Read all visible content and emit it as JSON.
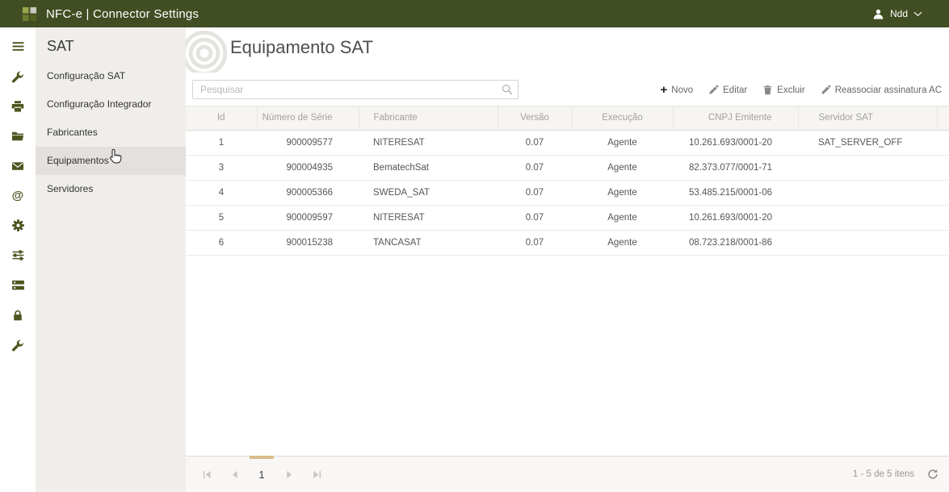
{
  "topbar": {
    "title": "NFC-e | Connector Settings",
    "user_name": "Ndd"
  },
  "sidebar": {
    "title": "SAT",
    "items": [
      {
        "label": "Configuração SAT",
        "active": false
      },
      {
        "label": "Configuração Integrador",
        "active": false
      },
      {
        "label": "Fabricantes",
        "active": false
      },
      {
        "label": "Equipamentos",
        "active": true
      },
      {
        "label": "Servidores",
        "active": false
      }
    ]
  },
  "main": {
    "title": "Equipamento SAT",
    "search_placeholder": "Pesquisar",
    "toolbar": {
      "novo": "Novo",
      "editar": "Editar",
      "excluir": "Excluir",
      "reassociar": "Reassociar assinatura AC"
    },
    "table": {
      "columns": [
        "Id",
        "Número de Série",
        "Fabricante",
        "Versão",
        "Execução",
        "CNPJ Emitente",
        "Servidor SAT"
      ],
      "rows": [
        [
          "1",
          "900009577",
          "NITERESAT",
          "0.07",
          "Agente",
          "10.261.693/0001-20",
          "SAT_SERVER_OFF"
        ],
        [
          "3",
          "900004935",
          "BematechSat",
          "0.07",
          "Agente",
          "82.373.077/0001-71",
          ""
        ],
        [
          "4",
          "900005366",
          "SWEDA_SAT",
          "0.07",
          "Agente",
          "53.485.215/0001-06",
          ""
        ],
        [
          "5",
          "900009597",
          "NITERESAT",
          "0.07",
          "Agente",
          "10.261.693/0001-20",
          ""
        ],
        [
          "6",
          "900015238",
          "TANCASAT",
          "0.07",
          "Agente",
          "08.723.218/0001-86",
          ""
        ]
      ]
    },
    "pager": {
      "page": "1",
      "info": "1 - 5 de 5 itens"
    }
  },
  "icons": {
    "rail": [
      "menu-icon",
      "tools-icon",
      "printer-icon",
      "folder-icon",
      "mail-icon",
      "at-icon",
      "gear-icon",
      "sliders-icon",
      "queue-icon",
      "lock-icon",
      "wrench-icon"
    ],
    "toolbar": [
      "plus-icon",
      "edit-pencil-icon",
      "trash-icon",
      "pencil-icon"
    ],
    "other": [
      "search-icon",
      "user-icon",
      "chevron-down-icon",
      "refresh-icon",
      "rings-icon",
      "hand-cursor-icon"
    ]
  },
  "colors": {
    "topbar_bg": "#414d22",
    "rail_icon": "#4c551f",
    "sidebar_bg": "#f0eeeb",
    "sidebar_active_bg": "#e3e0dd",
    "page_indicator": "#d9bd8b"
  }
}
